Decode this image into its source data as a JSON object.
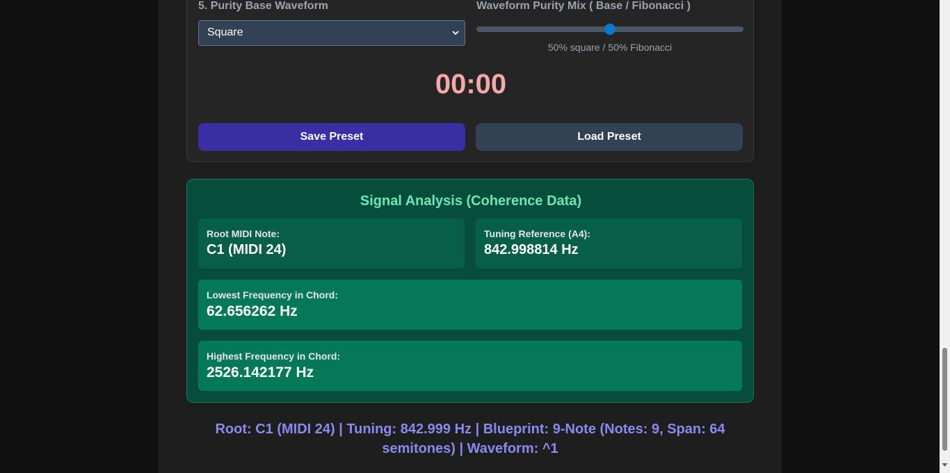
{
  "controls": {
    "waveform_label": "5. Purity Base Waveform",
    "waveform_selected": "Square",
    "mix_label": "Waveform Purity Mix ( Base / Fibonacci )",
    "mix_value": 0.5,
    "mix_caption": "50% square / 50% Fibonacci",
    "timer": "00:00",
    "save_label": "Save Preset",
    "load_label": "Load Preset"
  },
  "analysis": {
    "title": "Signal Analysis (Coherence Data)",
    "root_label": "Root MIDI Note:",
    "root_value": "C1 (MIDI 24)",
    "tuning_label": "Tuning Reference (A4):",
    "tuning_value": "842.998814 Hz",
    "lowest_label": "Lowest Frequency in Chord:",
    "lowest_value": "62.656262 Hz",
    "highest_label": "Highest Frequency in Chord:",
    "highest_value": "2526.142177 Hz"
  },
  "summary": "Root: C1 (MIDI 24) | Tuning: 842.999 Hz | Blueprint: 9-Note (Notes: 9, Span: 64 semitones) | Waveform: ^1",
  "colors": {
    "save_button": "#3a2ea5",
    "load_button": "#334155",
    "timer": "#f6a8a8",
    "analysis_title": "#6ee7b7",
    "summary": "#8b89f0",
    "slider_thumb": "#0b78d0"
  }
}
